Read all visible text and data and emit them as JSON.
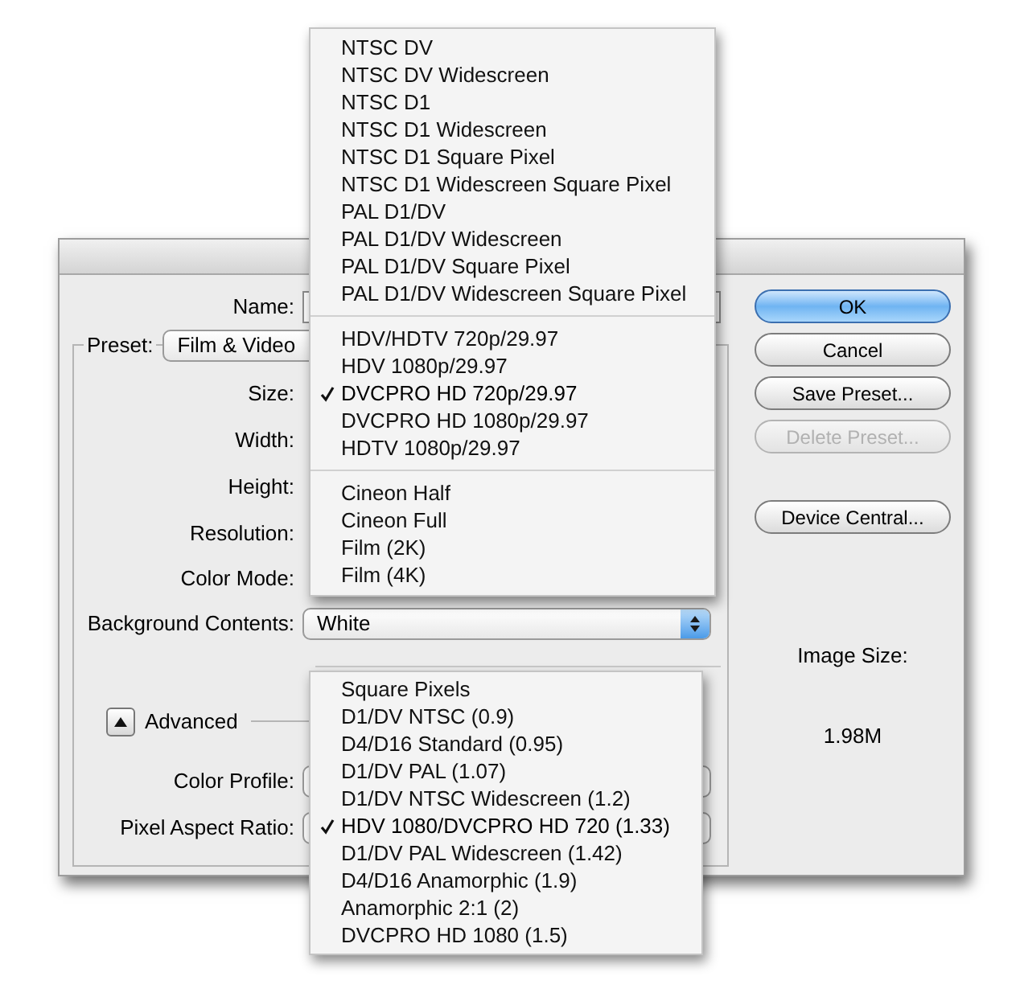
{
  "dialog": {
    "name_label": "Name:",
    "preset": {
      "label": "Preset:",
      "value": "Film & Video"
    },
    "rows": [
      {
        "label": "Size:"
      },
      {
        "label": "Width:"
      },
      {
        "label": "Height:"
      },
      {
        "label": "Resolution:"
      },
      {
        "label": "Color Mode:"
      }
    ],
    "background_contents": {
      "label": "Background Contents:",
      "value": "White"
    },
    "advanced": {
      "label": "Advanced",
      "expanded": true
    },
    "color_profile_label": "Color Profile:",
    "pixel_aspect_label": "Pixel Aspect Ratio:",
    "buttons": [
      {
        "label": "OK",
        "kind": "default",
        "disabled": false
      },
      {
        "label": "Cancel",
        "kind": "normal",
        "disabled": false
      },
      {
        "label": "Save Preset...",
        "kind": "normal",
        "disabled": false
      },
      {
        "label": "Delete Preset...",
        "kind": "normal",
        "disabled": true
      },
      {
        "label": "Device Central...",
        "kind": "spaced",
        "disabled": false
      }
    ],
    "image_size": {
      "label": "Image Size:",
      "value": "1.98M"
    }
  },
  "size_menu": {
    "groups": [
      [
        {
          "label": "NTSC DV",
          "selected": false
        },
        {
          "label": "NTSC DV Widescreen",
          "selected": false
        },
        {
          "label": "NTSC D1",
          "selected": false
        },
        {
          "label": "NTSC D1 Widescreen",
          "selected": false
        },
        {
          "label": "NTSC D1 Square Pixel",
          "selected": false
        },
        {
          "label": "NTSC D1 Widescreen Square Pixel",
          "selected": false
        },
        {
          "label": "PAL D1/DV",
          "selected": false
        },
        {
          "label": "PAL D1/DV Widescreen",
          "selected": false
        },
        {
          "label": "PAL D1/DV Square Pixel",
          "selected": false
        },
        {
          "label": "PAL D1/DV Widescreen Square Pixel",
          "selected": false
        }
      ],
      [
        {
          "label": "HDV/HDTV 720p/29.97",
          "selected": false
        },
        {
          "label": "HDV 1080p/29.97",
          "selected": false
        },
        {
          "label": "DVCPRO HD 720p/29.97",
          "selected": true
        },
        {
          "label": "DVCPRO HD 1080p/29.97",
          "selected": false
        },
        {
          "label": "HDTV 1080p/29.97",
          "selected": false
        }
      ],
      [
        {
          "label": "Cineon Half",
          "selected": false
        },
        {
          "label": "Cineon Full",
          "selected": false
        },
        {
          "label": "Film (2K)",
          "selected": false
        },
        {
          "label": "Film (4K)",
          "selected": false
        }
      ]
    ]
  },
  "pixel_aspect_menu": {
    "items": [
      {
        "label": "Square Pixels",
        "selected": false
      },
      {
        "label": "D1/DV NTSC (0.9)",
        "selected": false
      },
      {
        "label": "D4/D16 Standard (0.95)",
        "selected": false
      },
      {
        "label": "D1/DV PAL (1.07)",
        "selected": false
      },
      {
        "label": "D1/DV NTSC Widescreen (1.2)",
        "selected": false
      },
      {
        "label": "HDV 1080/DVCPRO HD 720 (1.33)",
        "selected": true
      },
      {
        "label": "D1/DV PAL Widescreen (1.42)",
        "selected": false
      },
      {
        "label": "D4/D16 Anamorphic (1.9)",
        "selected": false
      },
      {
        "label": "Anamorphic 2:1 (2)",
        "selected": false
      },
      {
        "label": "DVCPRO HD 1080 (1.5)",
        "selected": false
      }
    ]
  }
}
